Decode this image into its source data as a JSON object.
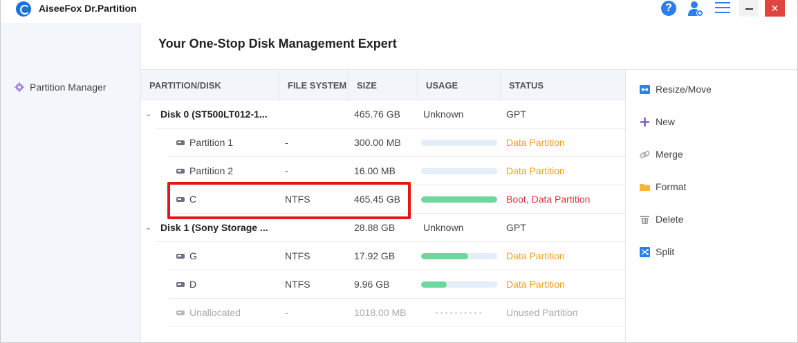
{
  "app": {
    "title": "AiseeFox Dr.Partition"
  },
  "titlebar": {
    "help_glyph": "?",
    "close_glyph": "✕"
  },
  "sidebar": {
    "items": [
      {
        "label": "Partition Manager",
        "icon": "gear-icon"
      }
    ]
  },
  "main": {
    "heading": "Your One-Stop Disk Management Expert"
  },
  "table": {
    "columns": [
      "PARTITION/DISK",
      "FILE SYSTEM",
      "SIZE",
      "USAGE",
      "STATUS"
    ],
    "rows": [
      {
        "type": "disk",
        "name": "Disk 0 (ST500LT012-1...",
        "fs": "",
        "size": "465.76 GB",
        "usage_text": "Unknown",
        "status": "GPT"
      },
      {
        "type": "partition",
        "name": "Partition 1",
        "fs": "-",
        "size": "300.00 MB",
        "usage_fraction": 0.0,
        "status": "Data Partition",
        "status_color": "#f0a022"
      },
      {
        "type": "partition",
        "name": "Partition 2",
        "fs": "-",
        "size": "16.00 MB",
        "usage_fraction": 0.0,
        "status": "Data Partition",
        "status_color": "#f0a022"
      },
      {
        "type": "partition",
        "name": "C",
        "fs": "NTFS",
        "size": "465.45 GB",
        "usage_fraction": 1.0,
        "status": "Boot, Data Partition",
        "status_color": "#d9363e",
        "highlighted": true
      },
      {
        "type": "disk",
        "name": "Disk 1 (Sony Storage ...",
        "fs": "",
        "size": "28.88 GB",
        "usage_text": "Unknown",
        "status": "GPT"
      },
      {
        "type": "partition",
        "name": "G",
        "fs": "NTFS",
        "size": "17.92 GB",
        "usage_fraction": 0.62,
        "status": "Data Partition",
        "status_color": "#f0a022"
      },
      {
        "type": "partition",
        "name": "D",
        "fs": "NTFS",
        "size": "9.96 GB",
        "usage_fraction": 0.34,
        "status": "Data Partition",
        "status_color": "#f0a022"
      },
      {
        "type": "unallocated",
        "name": "Unallocated",
        "fs": "-",
        "size": "1018.00 MB",
        "status": "Unused Partition"
      }
    ]
  },
  "actions": [
    {
      "label": "Resize/Move",
      "icon": "resize-icon",
      "color": "#2a7ef0"
    },
    {
      "label": "New",
      "icon": "plus-icon",
      "color": "#7a5cc8"
    },
    {
      "label": "Merge",
      "icon": "link-icon",
      "color": "#b0b0b0"
    },
    {
      "label": "Format",
      "icon": "folder-icon",
      "color": "#f5b731"
    },
    {
      "label": "Delete",
      "icon": "trash-icon",
      "color": "#9a9aa8"
    },
    {
      "label": "Split",
      "icon": "split-icon",
      "color": "#2a7ef0"
    }
  ],
  "colors": {
    "accent": "#2a7ef0",
    "usage_fill": "#6dd89e",
    "highlight_box": "#e31515"
  }
}
